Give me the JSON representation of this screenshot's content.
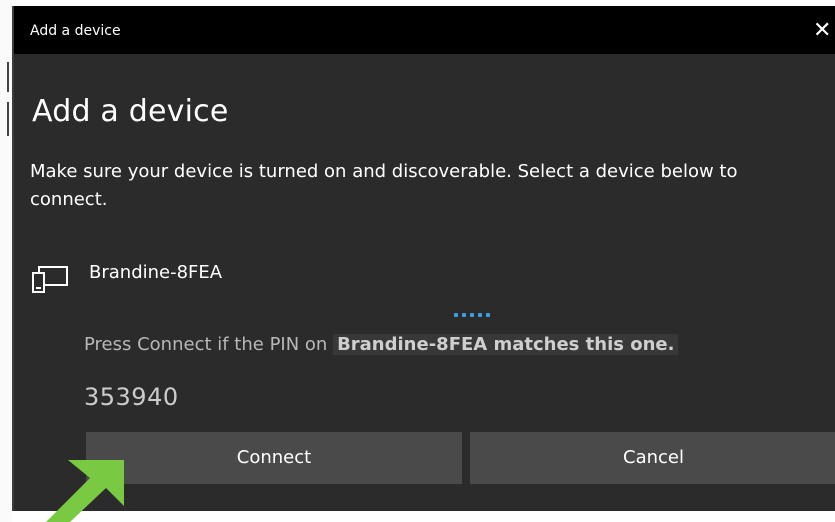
{
  "window": {
    "title": "Add a device",
    "close_glyph": "✕"
  },
  "dialog": {
    "heading": "Add a device",
    "instructions": "Make sure your device is turned on and discoverable. Select a device below to connect."
  },
  "device": {
    "name": "Brandine-8FEA",
    "icon": "device-icon"
  },
  "pairing": {
    "prompt_prefix": "Press Connect if the PIN on ",
    "prompt_device": "Brandine-8FEA matches this one.",
    "pin": "353940",
    "progress_dots": 5
  },
  "buttons": {
    "connect_label": "Connect",
    "cancel_label": "Cancel"
  },
  "colors": {
    "titlebar": "#000000",
    "dialog_bg": "#2b2b2b",
    "button_bg": "#4a4a4a",
    "progress_accent": "#3a9de8",
    "annotation_arrow": "#7ac943"
  }
}
